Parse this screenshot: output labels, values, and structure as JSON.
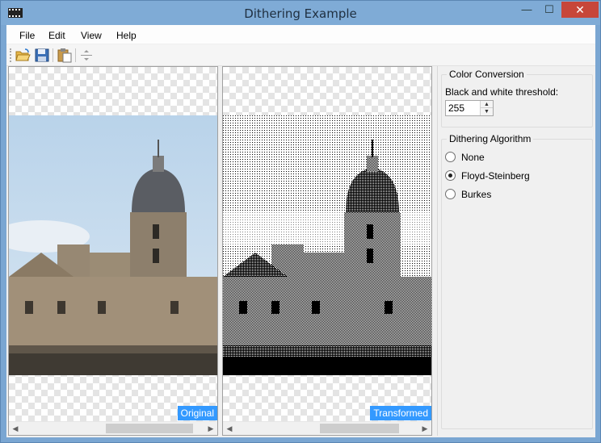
{
  "window": {
    "title": "Dithering Example",
    "minimize": "—",
    "maximize": "☐",
    "close": "✕"
  },
  "menu": {
    "items": [
      "File",
      "Edit",
      "View",
      "Help"
    ]
  },
  "toolbar": {
    "buttons": [
      "open-folder-icon",
      "save-disk-icon",
      "paste-clipboard-icon",
      "split-icon"
    ]
  },
  "panes": {
    "original_caption": "Original",
    "transformed_caption": "Transformed"
  },
  "color_conversion": {
    "title": "Color Conversion",
    "threshold_label": "Black and white threshold:",
    "threshold_value": "255"
  },
  "dithering": {
    "title": "Dithering Algorithm",
    "options": [
      {
        "label": "None",
        "checked": false
      },
      {
        "label": "Floyd-Steinberg",
        "checked": true
      },
      {
        "label": "Burkes",
        "checked": false
      }
    ]
  },
  "colors": {
    "accent": "#3399ff",
    "close": "#c7463a",
    "titlebar": "#7fabd6"
  }
}
